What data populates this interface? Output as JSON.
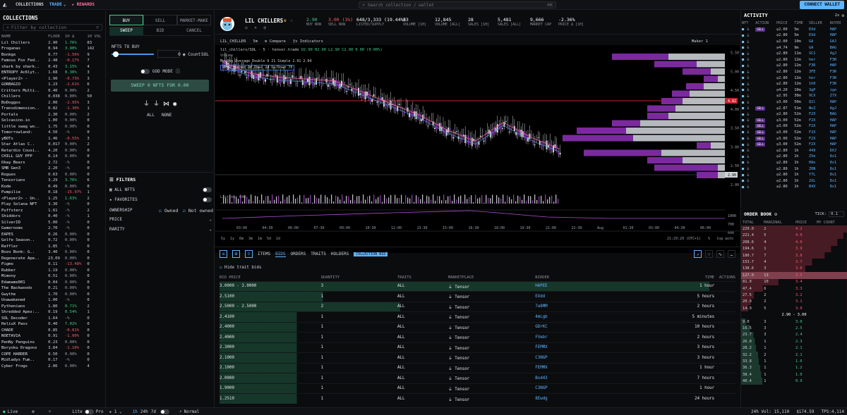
{
  "nav": {
    "collections": "COLLECTIONS",
    "trade": "TRADE",
    "rewards": "REWARDS",
    "search_placeholder": "Search collection / wallet",
    "search_shortcut": "⌘K",
    "connect": "CONNECT WALLET"
  },
  "collections": {
    "title": "COLLECTIONS",
    "filter_placeholder": "Filter by collection",
    "headers": [
      "NAME",
      "FLOOR",
      "1H Δ",
      "1H VOL"
    ],
    "rows": [
      [
        "Lil Chillers",
        "2.90",
        "1.76%",
        "83"
      ],
      [
        "Froganas",
        "0.94",
        "3.90%",
        "142"
      ],
      [
        "Bonkgo",
        "0.77",
        "-1.56%",
        "9"
      ],
      [
        "Famous Fox Fed..",
        "2.48",
        "-0.17%",
        "7"
      ],
      [
        "shark by shark..",
        "0.43",
        "3.15%",
        "4"
      ],
      [
        "ENTROPY Ac6lyt..",
        "1.68",
        "0.30%",
        "3"
      ],
      [
        "<Player2> -",
        "1.90",
        "-0.73%",
        "3"
      ],
      [
        "GORBAGIO",
        "1.23",
        "-2.61%",
        "6"
      ],
      [
        "Critters Multi..",
        "0.40",
        "0.00%",
        "2"
      ],
      [
        "Chillers",
        "0.038",
        "0.00%",
        "50"
      ],
      [
        "BoDoggos",
        "2.00",
        "-2.95%",
        "3"
      ],
      [
        "Transdimension..",
        "0.82",
        "-1.30%",
        "1"
      ],
      [
        "Portals",
        "2.30",
        "0.00%",
        "2"
      ],
      [
        "Solcasino.io",
        "1.00",
        "0.00%",
        "0"
      ],
      [
        "little swag wo..",
        "1.75",
        "0.00%",
        "0"
      ],
      [
        "Tomorrowland:",
        "4.50",
        "-%",
        "0"
      ],
      [
        "yBOTs",
        "1.46",
        "-0.55%",
        "3"
      ],
      [
        "Star Atlas C..",
        "0.017",
        "0.00%",
        "2"
      ],
      [
        "Retardio Cousi..",
        "4.20",
        "0.00%",
        "0"
      ],
      [
        "CHILL GUY PFP",
        "0.14",
        "0.00%",
        "0"
      ],
      [
        "Okay Bears",
        "2.72",
        "-%",
        "0"
      ],
      [
        "SMB Gen3",
        "2.20",
        "-%",
        "0"
      ],
      [
        "Rogues",
        "0.63",
        "0.00%",
        "0"
      ],
      [
        "Tensorians",
        "3.29",
        "3.76%",
        "6"
      ],
      [
        "Kode",
        "0.49",
        "0.00%",
        "0"
      ],
      [
        "Pumpilie",
        "0.18",
        "-15.97%",
        "1"
      ],
      [
        "<Player2> - Un..",
        "1.25",
        "1.63%",
        "2"
      ],
      [
        "Play Solana NFT",
        "3.30",
        "-%",
        "0"
      ],
      [
        "Puffsterz",
        "1.61",
        "-%",
        "2"
      ],
      [
        "Shiddors",
        "0.40",
        "-%",
        "1"
      ],
      [
        "SilverID",
        "5.00",
        "-%",
        "0"
      ],
      [
        "Gamerooms",
        "2.70",
        "-%",
        "0"
      ],
      [
        "EAPES",
        "0.26",
        "0.00%",
        "0"
      ],
      [
        "Golfe Season..",
        "0.72",
        "0.00%",
        "0"
      ],
      [
        "Raffler",
        "1.85",
        "-%",
        "0"
      ],
      [
        "Bozo Bonk: G..",
        "3.40",
        "0.00%",
        "0"
      ],
      [
        "Degenerate Ape..",
        "23.09",
        "0.00%",
        "0"
      ],
      [
        "Pigmo",
        "0.11",
        "-13.48%",
        "0"
      ],
      [
        "Rubber",
        "1.19",
        "0.00%",
        "0"
      ],
      [
        "Mimony",
        "0.51",
        "0.00%",
        "0"
      ],
      [
        "Edamame001",
        "0.04",
        "0.00%",
        "0"
      ],
      [
        "The Backwoods",
        "0.21",
        "0.00%",
        "0"
      ],
      [
        "Gwythe",
        "1.70",
        "0.00%",
        "0"
      ],
      [
        "Unawakened",
        "1.00",
        "-%",
        "0"
      ],
      [
        "Pythenians",
        "1.80",
        "0.71%",
        "2"
      ],
      [
        "Shredded Apes:..",
        "0.19",
        "0.54%",
        "1"
      ],
      [
        "SOL Decoder",
        "1.64",
        "-%",
        "0"
      ],
      [
        "HeliuX Pass",
        "0.40",
        "7.02%",
        "0"
      ],
      [
        "CHADE",
        "0.85",
        "-0.81%",
        "0"
      ],
      [
        "NOETAVIA",
        "0.91",
        "-1.00%",
        "0"
      ],
      [
        "PenNy Penguins",
        "0.23",
        "0.00%",
        "0"
      ],
      [
        "Boryoku Dragonz",
        "3.84",
        "-1.10%",
        "0"
      ],
      [
        "COPE HARDER",
        "0.50",
        "0.00%",
        "0"
      ],
      [
        "Midladys Fum..",
        "0.17",
        "-%",
        "0"
      ],
      [
        "Cyber Frogs",
        "2.06",
        "0.00%",
        "4"
      ]
    ]
  },
  "buy": {
    "tabs": [
      "BUY",
      "SELL",
      "MARKET-MAKE"
    ],
    "subtabs": [
      "SWEEP",
      "BID",
      "CANCEL"
    ],
    "nfts_to_buy": "NFTS TO BUY",
    "count_value": "0",
    "count_label": "Count",
    "currency": "SOL",
    "god_mode": "GOD MODE",
    "sweep_btn": "SWEEP 0 NFTS FOR 0.00",
    "all": "ALL",
    "none": "NONE",
    "filters": "FILTERS",
    "all_nfts": "ALL NFTS",
    "favorites": "FAVORITES",
    "ownership": "OWNERSHIP",
    "owned": "Owned",
    "not_owned": "Not owned",
    "price": "PRICE",
    "rarity": "RARITY"
  },
  "header": {
    "name": "LIL CHILLERS",
    "stats": [
      {
        "v": "2.90",
        "k": "BUY NOW"
      },
      {
        "v": "3.00 (3%)",
        "k": "SELL NOW"
      },
      {
        "v": "648/3,333 (19.44%)",
        "k": "LISTED/SUPPLY"
      },
      {
        "v": "83",
        "k": "VOLUME [1H]"
      },
      {
        "v": "12,845",
        "k": "VOLUME [ALL]"
      },
      {
        "v": "28",
        "k": "SALES [1H]"
      },
      {
        "v": "5,481",
        "k": "SALES [ALL]"
      },
      {
        "v": "9,666",
        "k": "MARKET CAP"
      },
      {
        "v": "-2.36%",
        "k": "PRICE Δ [1H]"
      }
    ]
  },
  "chart_toolbar": {
    "symbol": "LIL_CHILLER",
    "tf": "5m",
    "pair": "lil_chillers/SOL · 5 · tensor.trade",
    "ohlc": "O2.90 H2.90 L2.90 C2.90 0.00 (0.00%)",
    "compare": "Compare",
    "indicators": "Indicators",
    "maker": "Maker 1",
    "ma_line": "Moving Average Double 9 21 Simple 2.91 2.94",
    "vpvr": "VPVR Number Of Rows 24 Up/Down 70",
    "volume": "Volume",
    "listings": "Listings 648"
  },
  "chart_data": {
    "type": "line",
    "title": "",
    "x": [
      "03:00",
      "04:30",
      "06:00",
      "07:30",
      "09:00",
      "10:30",
      "12:00",
      "13:30",
      "15:00",
      "16:30",
      "18:00",
      "19:30",
      "21:00",
      "22:30",
      "Aug",
      "01:30",
      "03:00",
      "04:30",
      "06:00"
    ],
    "series": [
      {
        "values": [
          5.2,
          4.9,
          4.8,
          4.75,
          4.7,
          4.4,
          4.1,
          3.8,
          3.4,
          3.1,
          3.6,
          3.2,
          2.9
        ]
      }
    ],
    "y_ticks": [
      "5.50",
      "5.00",
      "4.50",
      "4.00",
      "3.50",
      "3.00",
      "2.50",
      "2.00"
    ],
    "ylim": [
      2.0,
      5.7
    ],
    "last_price": "2.90",
    "red_line": "4.82",
    "vol_ticks": [
      "1000",
      "700",
      "600"
    ],
    "timeframes": [
      "5y",
      "1y",
      "6m",
      "3m",
      "1m",
      "5d",
      "1d"
    ],
    "clock": "21:29:20 (UTC+1)",
    "scale": [
      "%",
      "log",
      "auto"
    ]
  },
  "bids": {
    "tabs": [
      "ITEMS",
      "BIDS",
      "ORDERS",
      "TRAITS",
      "HOLDERS",
      "COLLECTION BID"
    ],
    "hide_trait": "Hide trait bids",
    "headers": [
      "BID PRICE",
      "QUANTITY",
      "TRAITS",
      "MARKETPLACE",
      "BIDDER",
      "TIME",
      "ACTIONS"
    ],
    "rows": [
      [
        "3.0000 - 3.0000",
        "3",
        "ALL",
        "Tensor",
        "HAPEE",
        "1 hour"
      ],
      [
        "2.5100",
        "1",
        "ALL",
        "Tensor",
        "EXdd",
        "5 hours"
      ],
      [
        "2.5000 - 2.5000",
        "2",
        "ALL",
        "Tensor",
        "7a8MM",
        "2 hours"
      ],
      [
        "2.4100",
        "1",
        "ALL",
        "Tensor",
        "4mLgb",
        "5 minutes"
      ],
      [
        "2.4000",
        "1",
        "ALL",
        "Tensor",
        "GDrKC",
        "10 hours"
      ],
      [
        "2.4000",
        "1",
        "ALL",
        "Tensor",
        "FVebr",
        "2 hours"
      ],
      [
        "2.3000",
        "1",
        "ALL",
        "Tensor",
        "FEMMX",
        "3 hours"
      ],
      [
        "2.1000",
        "1",
        "ALL",
        "Tensor",
        "C3NGP",
        "3 hours"
      ],
      [
        "2.1000",
        "1",
        "ALL",
        "Tensor",
        "FEMMX",
        "1 hour"
      ],
      [
        "2.0000",
        "1",
        "ALL",
        "Tensor",
        "Bsd43",
        "7 hours"
      ],
      [
        "1.9000",
        "1",
        "ALL",
        "Tensor",
        "C3NGP",
        "1 hour"
      ],
      [
        "1.2510",
        "1",
        "ALL",
        "Tensor",
        "8Ewdg",
        "24 hours"
      ]
    ]
  },
  "activity": {
    "title": "ACTIVITY",
    "mode": "2x",
    "headers": [
      "NFT",
      "ACTION",
      "PRICE",
      "TIME",
      "SELLER",
      "BUYER"
    ],
    "rows": [
      [
        "SELL",
        "2.00",
        "5m",
        "EXd",
        "HAP"
      ],
      [
        "BUY",
        "2.80",
        "5m",
        "EXd",
        "HAP"
      ],
      [
        "BUY",
        "2.00",
        "10m",
        "GA",
        "GAJ"
      ],
      [
        "BUY",
        "4.74",
        "9m",
        "GA",
        "BAG"
      ],
      [
        "BUY",
        "2.80",
        "11m",
        "SC1",
        "4gJ"
      ],
      [
        "BUY",
        "2.80",
        "12m",
        "her",
        "F3R"
      ],
      [
        "BUY",
        "2.80",
        "12m",
        "F3R",
        "HAP"
      ],
      [
        "BUY",
        "2.80",
        "12m",
        "3FE",
        "F3R"
      ],
      [
        "BUY",
        "2.80",
        "12m",
        "her",
        "F3R"
      ],
      [
        "BUY",
        "2.80",
        "12m",
        "1h0",
        "F3R"
      ],
      [
        "BUY",
        "4.20",
        "10m",
        "3gP",
        "igo"
      ],
      [
        "BUY",
        "2.95",
        "30m",
        "9CX",
        "Z7X"
      ],
      [
        "BUY",
        "3.00",
        "50m",
        "Q1l",
        "HAP"
      ],
      [
        "SELL",
        "2.87",
        "51m",
        "NoZ",
        "AgJ"
      ],
      [
        "BUY",
        "2.80",
        "52m",
        "F2X",
        "BAG"
      ],
      [
        "SELL",
        "3.00",
        "52m",
        "F2X",
        "HAP"
      ],
      [
        "SELL",
        "3.00",
        "52m",
        "F2X",
        "HAP"
      ],
      [
        "SELL",
        "3.00",
        "52m",
        "F2X",
        "HAP"
      ],
      [
        "SELL",
        "3.00",
        "52m",
        "F2X",
        "HAP"
      ],
      [
        "SELL",
        "3.00",
        "52m",
        "F2X",
        "HAP"
      ],
      [
        "BUY",
        "2.80",
        "1h",
        "449",
        "DXJ"
      ],
      [
        "BUY",
        "2.80",
        "1h",
        "ZVe",
        "8s1"
      ],
      [
        "BUY",
        "2.80",
        "1h",
        "HAo",
        "8s1"
      ],
      [
        "BUY",
        "2.80",
        "1h",
        "Z6N",
        "8s1"
      ],
      [
        "BUY",
        "2.80",
        "1h",
        "Y7L",
        "8s1"
      ],
      [
        "BUY",
        "2.80",
        "1h",
        "2XL",
        "8s1"
      ],
      [
        "BUY",
        "2.80",
        "1h",
        "B4X",
        "8s1"
      ]
    ]
  },
  "orderbook": {
    "title": "ORDER BOOK",
    "tick_label": "TICK:",
    "tick": "0.1",
    "headers": [
      "TOTAL",
      "MARGINAL",
      "PRICE",
      "MY COUNT"
    ],
    "asks": [
      [
        "229.0",
        "2",
        "4.2"
      ],
      [
        "221.4",
        "5",
        "4.0"
      ],
      [
        "208.6",
        "4",
        "4.0"
      ],
      [
        "194.6",
        "1",
        "3.9"
      ],
      [
        "180.7",
        "7",
        "3.8"
      ],
      [
        "153.7",
        "4",
        "3.7"
      ],
      [
        "138.6",
        "3",
        "3.6"
      ],
      [
        "127.0",
        "13",
        "3.5"
      ],
      [
        "81.0",
        "10",
        "3.4"
      ],
      [
        "47.4",
        "6",
        "3.3"
      ],
      [
        "27.5",
        "2",
        "3.2"
      ],
      [
        "20.9",
        "2",
        "3.1"
      ],
      [
        "14.9",
        "5",
        "3.0"
      ]
    ],
    "spread": "2.90 - 3.00",
    "bids": [
      [
        "9.0",
        "3",
        "3.0"
      ],
      [
        "16.5",
        "3",
        "2.5"
      ],
      [
        "23.7",
        "3",
        "2.4"
      ],
      [
        "26.0",
        "1",
        "2.3"
      ],
      [
        "28.2",
        "1",
        "2.1"
      ],
      [
        "32.2",
        "2",
        "2.1"
      ],
      [
        "33.8",
        "1",
        "1.6"
      ],
      [
        "36.3",
        "1",
        "1.2"
      ],
      [
        "38.4",
        "1",
        "1.0"
      ],
      [
        "40.4",
        "1",
        "0.9"
      ]
    ]
  },
  "status": {
    "live": "Live",
    "lite": "Lite",
    "pro": "Pro",
    "tf": "1h",
    "tf2": "24h",
    "tf3": "7d",
    "normal": "Normal",
    "vol": "24h Vol: 15,110",
    "sol": "$174.59",
    "tps": "TPS:4,114"
  }
}
